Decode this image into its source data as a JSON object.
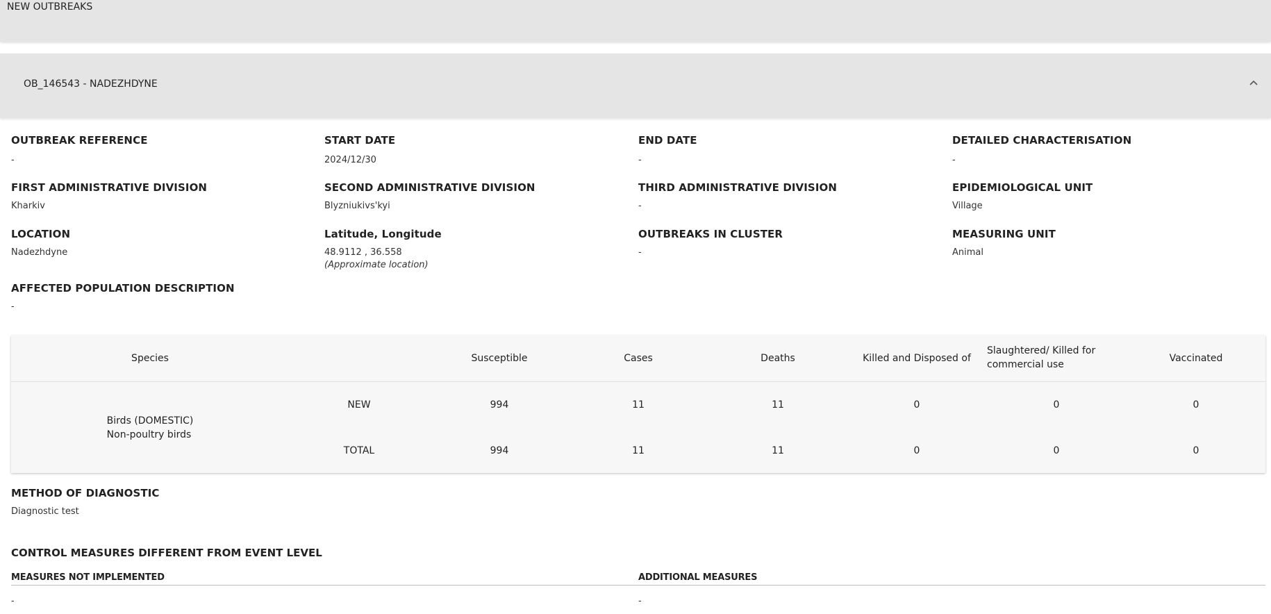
{
  "top_bar": {
    "title": "NEW OUTBREAKS"
  },
  "outbreak": {
    "header_title": "OB_146543 - NADEZHDYNE",
    "fields": {
      "outbreak_reference": {
        "label": "OUTBREAK REFERENCE",
        "value": "-"
      },
      "start_date": {
        "label": "START DATE",
        "value": "2024/12/30"
      },
      "end_date": {
        "label": "END DATE",
        "value": "-"
      },
      "detailed_characterisation": {
        "label": "DETAILED CHARACTERISATION",
        "value": "-"
      },
      "first_admin": {
        "label": "FIRST ADMINISTRATIVE DIVISION",
        "value": "Kharkiv"
      },
      "second_admin": {
        "label": "SECOND ADMINISTRATIVE DIVISION",
        "value": "Blyzniukivs'kyi"
      },
      "third_admin": {
        "label": "THIRD ADMINISTRATIVE DIVISION",
        "value": "-"
      },
      "epi_unit": {
        "label": "EPIDEMIOLOGICAL UNIT",
        "value": "Village"
      },
      "location": {
        "label": "LOCATION",
        "value": "Nadezhdyne"
      },
      "lat_long": {
        "label": "Latitude, Longitude",
        "value": "48.9112 , 36.558",
        "note": "(Approximate location)"
      },
      "outbreaks_in_cluster": {
        "label": "OUTBREAKS IN CLUSTER",
        "value": "-"
      },
      "measuring_unit": {
        "label": "MEASURING UNIT",
        "value": "Animal"
      },
      "affected_population": {
        "label": "AFFECTED POPULATION DESCRIPTION",
        "value": "-"
      }
    },
    "table": {
      "headers": {
        "species": "Species",
        "susceptible": "Susceptible",
        "cases": "Cases",
        "deaths": "Deaths",
        "killed_disposed": "Killed and Disposed of",
        "slaughtered": "Slaughtered/ Killed for commercial use",
        "vaccinated": "Vaccinated"
      },
      "species_line1": "Birds (DOMESTIC)",
      "species_line2": "Non-poultry birds",
      "rows": [
        {
          "type": "NEW",
          "susceptible": "994",
          "cases": "11",
          "deaths": "11",
          "killed_disposed": "0",
          "slaughtered": "0",
          "vaccinated": "0"
        },
        {
          "type": "TOTAL",
          "susceptible": "994",
          "cases": "11",
          "deaths": "11",
          "killed_disposed": "0",
          "slaughtered": "0",
          "vaccinated": "0"
        }
      ]
    },
    "method_of_diagnostic": {
      "label": "METHOD OF DIAGNOSTIC",
      "value": "Diagnostic test"
    },
    "control_measures": {
      "title": "CONTROL MEASURES DIFFERENT FROM EVENT LEVEL",
      "not_implemented": {
        "label": "MEASURES NOT IMPLEMENTED",
        "value": "-"
      },
      "additional": {
        "label": "ADDITIONAL MEASURES",
        "value": "-"
      }
    }
  },
  "icons": {
    "collapse": "chevron-up-icon"
  }
}
